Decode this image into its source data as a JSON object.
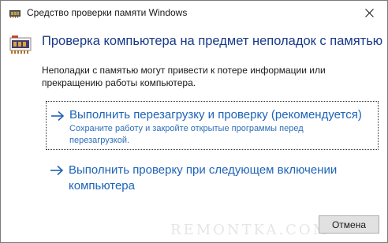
{
  "window": {
    "title": "Средство проверки памяти Windows"
  },
  "header": {
    "title": "Проверка компьютера на предмет неполадок с памятью"
  },
  "description": "Неполадки с памятью могут привести к потере информации или прекращению работы компьютера.",
  "options": [
    {
      "title": "Выполнить перезагрузку и проверку (рекомендуется)",
      "subtitle": "Сохраните работу и закройте открытые программы перед перезагрузкой."
    },
    {
      "title": "Выполнить проверку при следующем включении компьютера"
    }
  ],
  "buttons": {
    "cancel": "Отмена"
  },
  "watermark": "REMONTKA.COM",
  "icons": {
    "title": "memory-chip-icon",
    "header": "memory-chip-icon",
    "close": "close-icon",
    "arrow": "arrow-right-icon"
  },
  "colors": {
    "header_title": "#1a3a8a",
    "link": "#1e63b8"
  }
}
